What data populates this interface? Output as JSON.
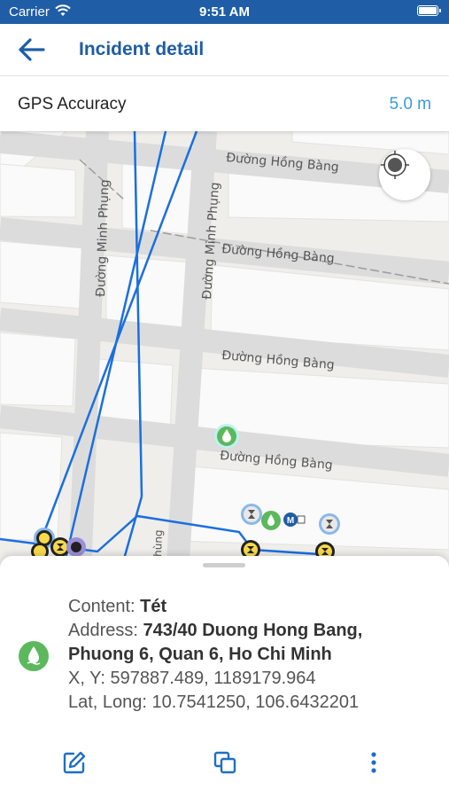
{
  "status_bar": {
    "carrier": "Carrier",
    "time": "9:51 AM"
  },
  "header": {
    "title": "Incident detail",
    "back_icon": "arrow-left-icon"
  },
  "gps": {
    "label": "GPS Accuracy",
    "value": "5.0 m"
  },
  "map": {
    "streets": {
      "hong_bang_1": "Đường Hồng Bàng",
      "hong_bang_2": "Đường Hồng Bàng",
      "hong_bang_3": "Đường Hồng Bàng",
      "hong_bang_4": "Đường Hồng Bàng",
      "minh_phung_1": "Đường Minh Phụng",
      "minh_phung_2": "Đường Minh Phụng",
      "partial": "hùng"
    },
    "marker_letter": "M"
  },
  "incident": {
    "content_label": "Content:",
    "content_value": "Tét",
    "address_label": "Address:",
    "address_value": "743/40 Duong Hong Bang, Phuong 6, Quan 6, Ho Chi Minh",
    "xy_label": "X, Y:",
    "xy_value": "597887.489, 1189179.964",
    "latlong_label": "Lat, Long:",
    "latlong_value": "10.7541250, 106.6432201"
  },
  "actions": [
    "edit-icon",
    "copy-icon",
    "more-vertical-icon"
  ],
  "colors": {
    "brand": "#1f5da6",
    "accent": "#3d9ad9",
    "incident": "#5cb85c",
    "pipeline": "#1a6fe0"
  }
}
